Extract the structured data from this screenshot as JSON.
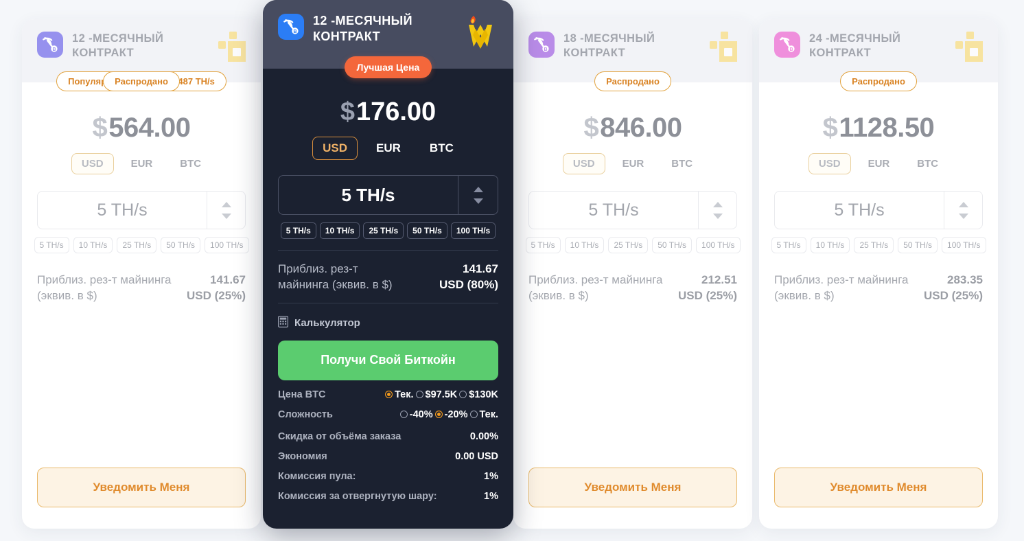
{
  "cards": [
    {
      "id": "card-12m-left",
      "title": "12 -МЕСЯЧНЫЙ КОНТРАКТ",
      "icon_color": "#9691ee",
      "badges": [
        {
          "name": "availability-badge",
          "label": "Популярный • Осталось 487 TH/s"
        },
        {
          "name": "soldout-badge",
          "label": "Распродано"
        }
      ],
      "currency_symbol": "$",
      "price": "564.00",
      "currencies": [
        "USD",
        "EUR",
        "BTC"
      ],
      "currency_selected": "USD",
      "hashrate_value": "5 TH/s",
      "hashrate_presets": [
        "5 TH/s",
        "10 TH/s",
        "25 TH/s",
        "50 TH/s",
        "100 TH/s"
      ],
      "reward_label": "Приблиз. рез-т майнинга (эквив. в $)",
      "reward_value": "141.67 USD (25%)",
      "reward_value_line1": "141.67",
      "reward_value_line2": "USD (25%)",
      "notify_label": "Уведомить Меня"
    },
    {
      "id": "card-18m",
      "title": "18 -МЕСЯЧНЫЙ КОНТРАКТ",
      "icon_color": "#b98ce8",
      "badges": [
        {
          "name": "soldout-badge",
          "label": "Распродано"
        }
      ],
      "currency_symbol": "$",
      "price": "846.00",
      "currencies": [
        "USD",
        "EUR",
        "BTC"
      ],
      "currency_selected": "USD",
      "hashrate_value": "5 TH/s",
      "hashrate_presets": [
        "5 TH/s",
        "10 TH/s",
        "25 TH/s",
        "50 TH/s",
        "100 TH/s"
      ],
      "reward_label": "Приблиз. рез-т майнинга (эквив. в $)",
      "reward_value": "212.51 USD (25%)",
      "reward_value_line1": "212.51",
      "reward_value_line2": "USD (25%)",
      "notify_label": "Уведомить Меня"
    },
    {
      "id": "card-24m",
      "title": "24 -МЕСЯЧНЫЙ КОНТРАКТ",
      "icon_color": "#ef8fdc",
      "badges": [
        {
          "name": "soldout-badge",
          "label": "Распродано"
        }
      ],
      "currency_symbol": "$",
      "price": "1128.50",
      "currencies": [
        "USD",
        "EUR",
        "BTC"
      ],
      "currency_selected": "USD",
      "hashrate_value": "5 TH/s",
      "hashrate_presets": [
        "5 TH/s",
        "10 TH/s",
        "25 TH/s",
        "50 TH/s",
        "100 TH/s"
      ],
      "reward_label": "Приблиз. рез-т майнинга (эквив. в $)",
      "reward_value": "283.35 USD (25%)",
      "reward_value_line1": "283.35",
      "reward_value_line2": "USD (25%)",
      "notify_label": "Уведомить Меня"
    }
  ],
  "featured": {
    "id": "card-12m-featured",
    "title": "12 -МЕСЯЧНЫЙ КОНТРАКТ",
    "icon_color": "#2b7df5",
    "logo_name": "mining-wizard-flame-logo",
    "badge": "Лучшая Цена",
    "badge_color": "#f4673b",
    "currency_symbol": "$",
    "price": "176.00",
    "currencies": [
      "USD",
      "EUR",
      "BTC"
    ],
    "currency_selected": "USD",
    "hashrate_value": "5 TH/s",
    "hashrate_presets": [
      "5 TH/s",
      "10 TH/s",
      "25 TH/s",
      "50 TH/s",
      "100 TH/s"
    ],
    "reward_label_line1": "Приблиз. рез-т",
    "reward_label_line2": "майнинга (эквив. в $)",
    "reward_value_line1": "141.67",
    "reward_value_line2": "USD (80%)",
    "calculator_label": "Калькулятор",
    "cta_label": "Получи Свой Биткойн",
    "accent_color": "#f59b1c",
    "cta_color": "#5bcc6f",
    "btc_price": {
      "label": "Цена BTC",
      "options": [
        "Тек.",
        "$97.5K",
        "$130K"
      ],
      "selected": "Тек."
    },
    "difficulty": {
      "label": "Сложность",
      "options": [
        "-40%",
        "-20%",
        "Тек."
      ],
      "selected": "-20%"
    },
    "rows": [
      {
        "key": "Скидка от объёма заказа",
        "value": "0.00%"
      },
      {
        "key": "Экономия",
        "value": "0.00 USD"
      },
      {
        "key": "Комиссия пула:",
        "value": "1%"
      },
      {
        "key": "Комиссия за отвергнутую шару:",
        "value": "1%"
      }
    ]
  }
}
